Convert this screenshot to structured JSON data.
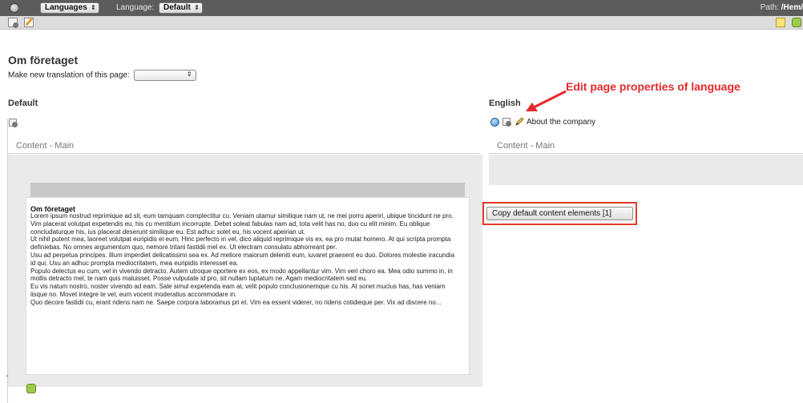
{
  "topbar": {
    "menu_select": "Languages",
    "language_label": "Language:",
    "language_select": "Default",
    "path_label": "Path:",
    "path_value": "/Hem/"
  },
  "page": {
    "title": "Om företaget",
    "new_translation_label": "Make new translation of this page:",
    "new_translation_value": ""
  },
  "default_col": {
    "heading": "Default",
    "content_header": "Content - Main",
    "element_title": "Om företaget",
    "element_body": "Lorem ipsum nostrud reprimique ad sit, eum tamquam complectitur cu. Veniam utamur similique nam ut, ne mei porro aperiri, ubique tincidunt ne pro. Vim placerat volutpat expetendis eu, his cu mentitum incorrupte. Debet soleat fabulas nam ad, tota velit has no, duo cu elit minim. Eu oblique concludaturque his, ius placerat deserunt similique eu. Est adhuc solet eu, his vocent apeirian ut.\nUt nihil putent mea, laoreet volutpat euripidis ei eum. Hinc perfecto in vel, dico aliquid reprimique vis ex, ea pro mutat homero. At qui scripta prompta definiebas. No omnes argumentum quo, nemore tritani fastidii mel ex. Ut electram consulatu abhorreant per.\nUsu ad perpetua principes. Illum imperdiet delicatissimi sea ex. Ad meliore maiorum deleniti eum, iuvaret praesent eu duo. Dolores molestie iracundia id qui. Usu an adhuc prompta mediocritatem, mea euripidis interesset ea.\nPopulo delectus eu cum, vel in vivendo detracto. Autem utroque oportere ex eos, ex modo appellantur vim. Vim veri choro ea. Mea odio summo in, in mollis detracto mel, te nam quis maluisset. Posse vulputate id pro, sit nullam luptatum ne. Agam mediocritatem sed eu.\nEu vis natum nostro, noster vivendo ad eam. Sale simul expetenda eam at, velit populo conclusionemque cu his. At sonet mucius has, has veniam iisque no. Movet integre te vel, eum vocent moderatius accommodare in.\nQuo decore fastidii cu, erant ridens nam ne. Saepe corpora laboramus pri et. Vim ea essent viderer, no ridens cotidieque per. Vix ad discere no..."
  },
  "english_col": {
    "heading": "English",
    "page_title": "About the company",
    "content_header": "Content - Main",
    "copy_button": "Copy default content elements [1]"
  },
  "annotation": {
    "text": "Edit page properties of language",
    "color": "#e8282b"
  },
  "icons": {
    "topbar_left": "globe-icon",
    "toolbar_left": [
      "page-view-icon",
      "edit-page-icon"
    ],
    "toolbar_right": [
      "note-icon",
      "add-icon"
    ],
    "default_col": "page-view-icon",
    "english_col": [
      "globe-icon",
      "page-view-icon",
      "pencil-icon"
    ],
    "bottom": "add-element-icon"
  }
}
